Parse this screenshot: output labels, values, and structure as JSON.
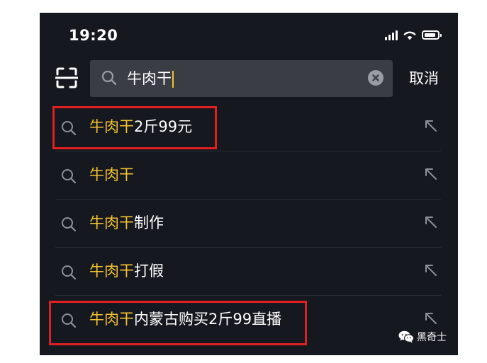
{
  "status_bar": {
    "time": "19:20"
  },
  "search": {
    "query": "牛肉干",
    "cancel_label": "取消"
  },
  "suggestions": [
    {
      "highlight": "牛肉干",
      "rest": "2斤99元",
      "boxed": true
    },
    {
      "highlight": "牛肉干",
      "rest": "",
      "boxed": false
    },
    {
      "highlight": "牛肉干",
      "rest": "制作",
      "boxed": false
    },
    {
      "highlight": "牛肉干",
      "rest": "打假",
      "boxed": false
    },
    {
      "highlight": "牛肉干",
      "rest": "内蒙古购买2斤99直播",
      "boxed": true
    }
  ],
  "watermark": {
    "text": "黑奇士"
  },
  "colors": {
    "background": "#16181f",
    "highlight": "#f2c230",
    "annotation_box": "#e02020"
  }
}
